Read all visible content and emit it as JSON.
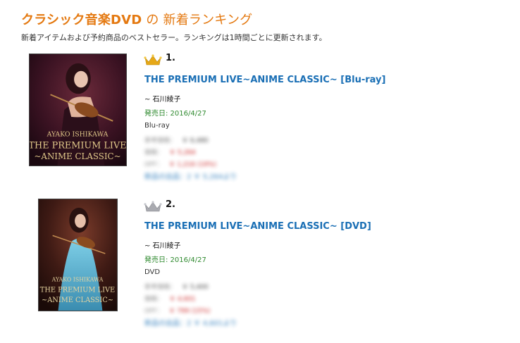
{
  "header": {
    "title_main": "クラシック音楽DVD",
    "title_suffix": " の 新着ランキング",
    "subtitle": "新着アイテムおよび予約商品のベストセラー。ランキングは1時間ごとに更新されます。"
  },
  "items": [
    {
      "rank": "1.",
      "crown_color": "#e6a817",
      "title": "THE PREMIUM LIVE~ANIME CLASSIC~ [Blu-ray]",
      "artist": "~ 石川綾子",
      "release_date": "発売日: 2016/4/27",
      "format": "Blu-ray",
      "cover_text": [
        "AYAKO ISHIKAWA",
        "THE PREMIUM LIVE",
        "~ANIME CLASSIC~"
      ],
      "blurred": {
        "list_label": "参考価格：",
        "list_value": "￥ 6,480",
        "price_label": "価格：",
        "price_value": "￥ 5,264",
        "off_label": "OFF：",
        "off_value": "￥ 1,216 (19%)",
        "others": "新品の出品：2 ￥ 5,264より"
      }
    },
    {
      "rank": "2.",
      "crown_color": "#a9aab0",
      "title": "THE PREMIUM LIVE~ANIME CLASSIC~ [DVD]",
      "artist": "~ 石川綾子",
      "release_date": "発売日: 2016/4/27",
      "format": "DVD",
      "cover_text": [
        "AYAKO ISHIKAWA",
        "THE PREMIUM LIVE",
        "~ANIME CLASSIC~"
      ],
      "blurred": {
        "list_label": "参考価格：",
        "list_value": "￥ 5,400",
        "price_label": "価格：",
        "price_value": "￥ 4,601",
        "off_label": "OFF：",
        "off_value": "￥ 799 (15%)",
        "others": "新品の出品：2 ￥ 4,601より"
      }
    }
  ]
}
